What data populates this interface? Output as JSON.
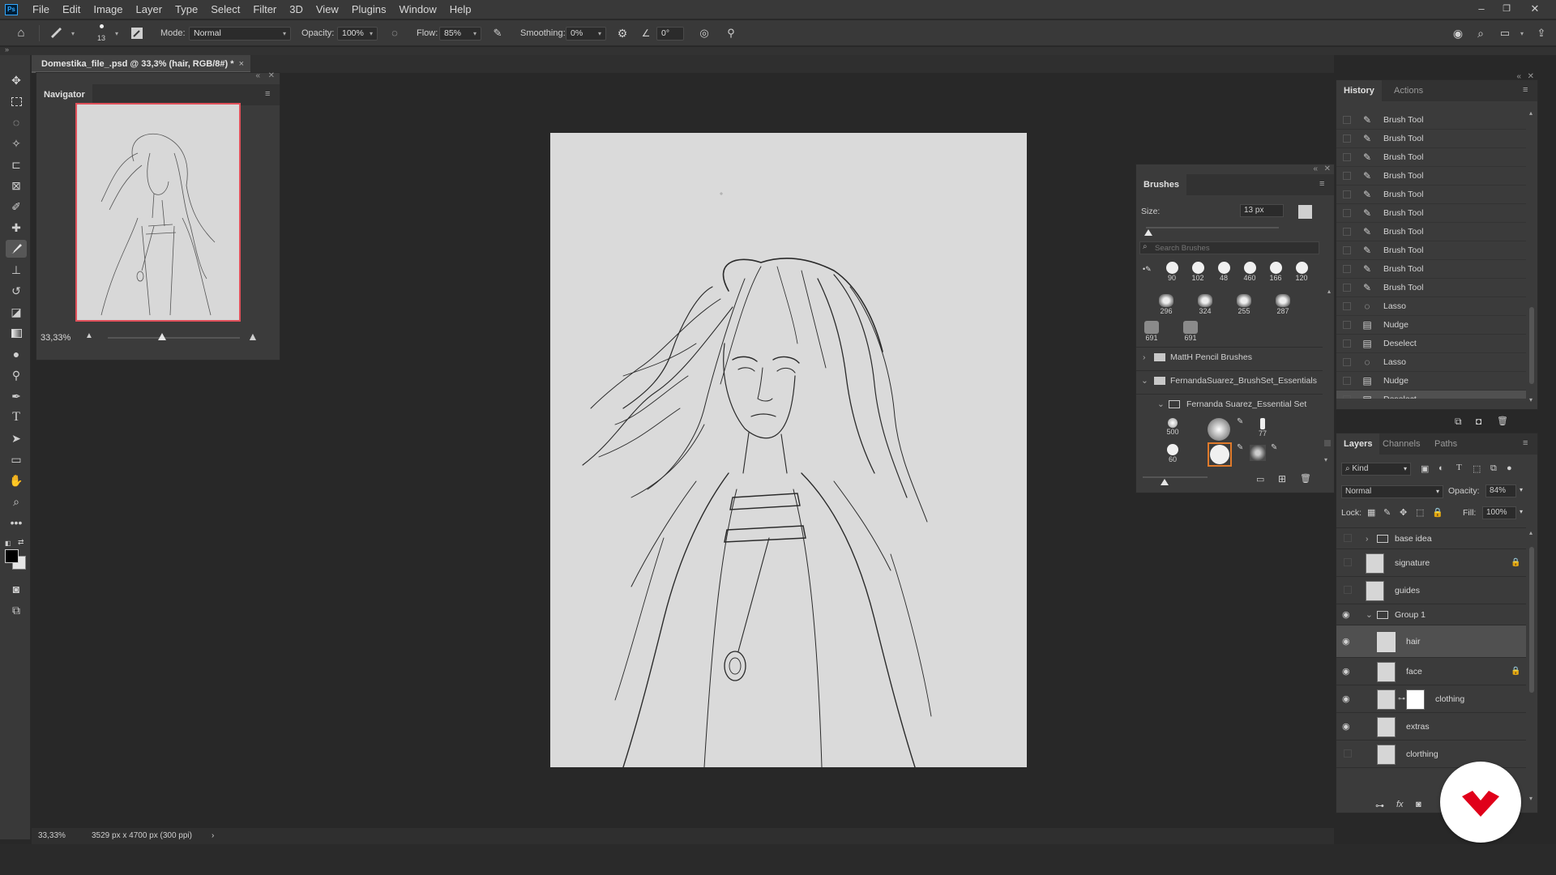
{
  "app": {
    "logo": "Ps"
  },
  "menu": [
    "File",
    "Edit",
    "Image",
    "Layer",
    "Type",
    "Select",
    "Filter",
    "3D",
    "View",
    "Plugins",
    "Window",
    "Help"
  ],
  "window_controls": {
    "minimize": "–",
    "restore": "❐",
    "close": "✕"
  },
  "options_bar": {
    "brush_size": "13",
    "mode_label": "Mode:",
    "mode_value": "Normal",
    "opacity_label": "Opacity:",
    "opacity_value": "100%",
    "flow_label": "Flow:",
    "flow_value": "85%",
    "smoothing_label": "Smoothing:",
    "smoothing_value": "0%",
    "angle_value": "0°"
  },
  "document_tab": {
    "title": "Domestika_file_.psd @ 33,3% (hair, RGB/8#) *",
    "close": "×"
  },
  "navigator": {
    "tab": "Navigator",
    "zoom": "33,33%"
  },
  "status_bar": {
    "zoom": "33,33%",
    "doc_info": "3529 px x 4700 px (300 ppi)",
    "arrow": "›"
  },
  "brushes_panel": {
    "tab": "Brushes",
    "size_label": "Size:",
    "size_value": "13 px",
    "search_placeholder": "Search Brushes",
    "recent_sizes": [
      "90",
      "102",
      "48",
      "460",
      "166",
      "120"
    ],
    "row2_sizes": [
      "296",
      "324",
      "255",
      "287"
    ],
    "row3_sizes": [
      "691",
      "691"
    ],
    "folders": [
      "MattH Pencil Brushes",
      "FernandaSuarez_BrushSet_Essentials",
      "Fernanda Suarez_Essential Set"
    ],
    "set_sizes": [
      "500",
      "77",
      "60"
    ]
  },
  "history_panel": {
    "tabs": [
      "History",
      "Actions"
    ],
    "items": [
      {
        "label": "Brush Tool",
        "icon": "brush-icon"
      },
      {
        "label": "Brush Tool",
        "icon": "brush-icon"
      },
      {
        "label": "Brush Tool",
        "icon": "brush-icon"
      },
      {
        "label": "Brush Tool",
        "icon": "brush-icon"
      },
      {
        "label": "Brush Tool",
        "icon": "brush-icon"
      },
      {
        "label": "Brush Tool",
        "icon": "brush-icon"
      },
      {
        "label": "Brush Tool",
        "icon": "brush-icon"
      },
      {
        "label": "Brush Tool",
        "icon": "brush-icon"
      },
      {
        "label": "Brush Tool",
        "icon": "brush-icon"
      },
      {
        "label": "Brush Tool",
        "icon": "brush-icon"
      },
      {
        "label": "Lasso",
        "icon": "lasso-icon"
      },
      {
        "label": "Nudge",
        "icon": "history-state-icon"
      },
      {
        "label": "Deselect",
        "icon": "history-state-icon"
      },
      {
        "label": "Lasso",
        "icon": "lasso-icon"
      },
      {
        "label": "Nudge",
        "icon": "history-state-icon"
      },
      {
        "label": "Deselect",
        "icon": "history-state-icon"
      }
    ]
  },
  "layers_panel": {
    "tabs": [
      "Layers",
      "Channels",
      "Paths"
    ],
    "filter_value": "Kind",
    "blend_mode": "Normal",
    "opacity_label": "Opacity:",
    "opacity_value": "84%",
    "lock_label": "Lock:",
    "fill_label": "Fill:",
    "fill_value": "100%",
    "layers": [
      {
        "name": "base idea",
        "type": "group",
        "visible": false,
        "locked": false
      },
      {
        "name": "signature",
        "type": "layer",
        "visible": false,
        "locked": true
      },
      {
        "name": "guides",
        "type": "layer",
        "visible": false,
        "locked": false
      },
      {
        "name": "Group 1",
        "type": "group",
        "visible": true,
        "locked": false
      },
      {
        "name": "hair",
        "type": "layer",
        "visible": true,
        "locked": false,
        "selected": true
      },
      {
        "name": "face",
        "type": "layer",
        "visible": true,
        "locked": true
      },
      {
        "name": "clothing",
        "type": "layer-mask",
        "visible": true,
        "locked": false
      },
      {
        "name": "extras",
        "type": "layer",
        "visible": true,
        "locked": false
      },
      {
        "name": "clorthing",
        "type": "layer",
        "visible": false,
        "locked": false
      }
    ]
  },
  "colors": {
    "accent_selection": "#e0505a",
    "brush_selected": "#e07a2a",
    "watermark": "#e0001a"
  }
}
